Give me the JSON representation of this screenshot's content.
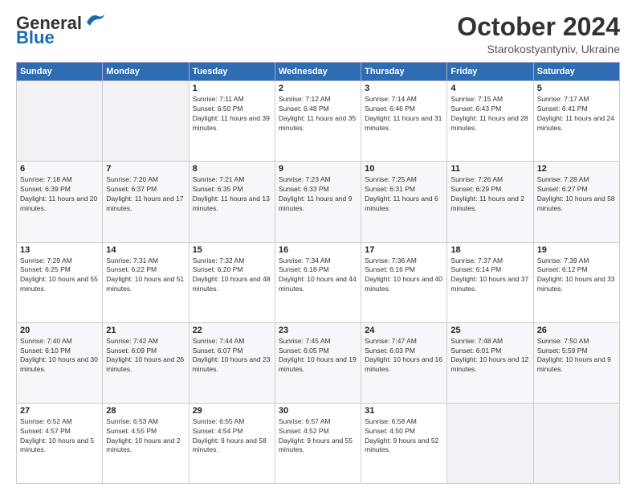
{
  "header": {
    "logo_general": "General",
    "logo_blue": "Blue",
    "month_title": "October 2024",
    "subtitle": "Starokostyantyniv, Ukraine"
  },
  "weekdays": [
    "Sunday",
    "Monday",
    "Tuesday",
    "Wednesday",
    "Thursday",
    "Friday",
    "Saturday"
  ],
  "weeks": [
    [
      {
        "day": "",
        "sunrise": "",
        "sunset": "",
        "daylight": "",
        "empty": true
      },
      {
        "day": "",
        "sunrise": "",
        "sunset": "",
        "daylight": "",
        "empty": true
      },
      {
        "day": "1",
        "sunrise": "Sunrise: 7:11 AM",
        "sunset": "Sunset: 6:50 PM",
        "daylight": "Daylight: 11 hours and 39 minutes.",
        "empty": false
      },
      {
        "day": "2",
        "sunrise": "Sunrise: 7:12 AM",
        "sunset": "Sunset: 6:48 PM",
        "daylight": "Daylight: 11 hours and 35 minutes.",
        "empty": false
      },
      {
        "day": "3",
        "sunrise": "Sunrise: 7:14 AM",
        "sunset": "Sunset: 6:46 PM",
        "daylight": "Daylight: 11 hours and 31 minutes.",
        "empty": false
      },
      {
        "day": "4",
        "sunrise": "Sunrise: 7:15 AM",
        "sunset": "Sunset: 6:43 PM",
        "daylight": "Daylight: 11 hours and 28 minutes.",
        "empty": false
      },
      {
        "day": "5",
        "sunrise": "Sunrise: 7:17 AM",
        "sunset": "Sunset: 6:41 PM",
        "daylight": "Daylight: 11 hours and 24 minutes.",
        "empty": false
      }
    ],
    [
      {
        "day": "6",
        "sunrise": "Sunrise: 7:18 AM",
        "sunset": "Sunset: 6:39 PM",
        "daylight": "Daylight: 11 hours and 20 minutes.",
        "empty": false
      },
      {
        "day": "7",
        "sunrise": "Sunrise: 7:20 AM",
        "sunset": "Sunset: 6:37 PM",
        "daylight": "Daylight: 11 hours and 17 minutes.",
        "empty": false
      },
      {
        "day": "8",
        "sunrise": "Sunrise: 7:21 AM",
        "sunset": "Sunset: 6:35 PM",
        "daylight": "Daylight: 11 hours and 13 minutes.",
        "empty": false
      },
      {
        "day": "9",
        "sunrise": "Sunrise: 7:23 AM",
        "sunset": "Sunset: 6:33 PM",
        "daylight": "Daylight: 11 hours and 9 minutes.",
        "empty": false
      },
      {
        "day": "10",
        "sunrise": "Sunrise: 7:25 AM",
        "sunset": "Sunset: 6:31 PM",
        "daylight": "Daylight: 11 hours and 6 minutes.",
        "empty": false
      },
      {
        "day": "11",
        "sunrise": "Sunrise: 7:26 AM",
        "sunset": "Sunset: 6:29 PM",
        "daylight": "Daylight: 11 hours and 2 minutes.",
        "empty": false
      },
      {
        "day": "12",
        "sunrise": "Sunrise: 7:28 AM",
        "sunset": "Sunset: 6:27 PM",
        "daylight": "Daylight: 10 hours and 58 minutes.",
        "empty": false
      }
    ],
    [
      {
        "day": "13",
        "sunrise": "Sunrise: 7:29 AM",
        "sunset": "Sunset: 6:25 PM",
        "daylight": "Daylight: 10 hours and 55 minutes.",
        "empty": false
      },
      {
        "day": "14",
        "sunrise": "Sunrise: 7:31 AM",
        "sunset": "Sunset: 6:22 PM",
        "daylight": "Daylight: 10 hours and 51 minutes.",
        "empty": false
      },
      {
        "day": "15",
        "sunrise": "Sunrise: 7:32 AM",
        "sunset": "Sunset: 6:20 PM",
        "daylight": "Daylight: 10 hours and 48 minutes.",
        "empty": false
      },
      {
        "day": "16",
        "sunrise": "Sunrise: 7:34 AM",
        "sunset": "Sunset: 6:18 PM",
        "daylight": "Daylight: 10 hours and 44 minutes.",
        "empty": false
      },
      {
        "day": "17",
        "sunrise": "Sunrise: 7:36 AM",
        "sunset": "Sunset: 6:16 PM",
        "daylight": "Daylight: 10 hours and 40 minutes.",
        "empty": false
      },
      {
        "day": "18",
        "sunrise": "Sunrise: 7:37 AM",
        "sunset": "Sunset: 6:14 PM",
        "daylight": "Daylight: 10 hours and 37 minutes.",
        "empty": false
      },
      {
        "day": "19",
        "sunrise": "Sunrise: 7:39 AM",
        "sunset": "Sunset: 6:12 PM",
        "daylight": "Daylight: 10 hours and 33 minutes.",
        "empty": false
      }
    ],
    [
      {
        "day": "20",
        "sunrise": "Sunrise: 7:40 AM",
        "sunset": "Sunset: 6:10 PM",
        "daylight": "Daylight: 10 hours and 30 minutes.",
        "empty": false
      },
      {
        "day": "21",
        "sunrise": "Sunrise: 7:42 AM",
        "sunset": "Sunset: 6:09 PM",
        "daylight": "Daylight: 10 hours and 26 minutes.",
        "empty": false
      },
      {
        "day": "22",
        "sunrise": "Sunrise: 7:44 AM",
        "sunset": "Sunset: 6:07 PM",
        "daylight": "Daylight: 10 hours and 23 minutes.",
        "empty": false
      },
      {
        "day": "23",
        "sunrise": "Sunrise: 7:45 AM",
        "sunset": "Sunset: 6:05 PM",
        "daylight": "Daylight: 10 hours and 19 minutes.",
        "empty": false
      },
      {
        "day": "24",
        "sunrise": "Sunrise: 7:47 AM",
        "sunset": "Sunset: 6:03 PM",
        "daylight": "Daylight: 10 hours and 16 minutes.",
        "empty": false
      },
      {
        "day": "25",
        "sunrise": "Sunrise: 7:48 AM",
        "sunset": "Sunset: 6:01 PM",
        "daylight": "Daylight: 10 hours and 12 minutes.",
        "empty": false
      },
      {
        "day": "26",
        "sunrise": "Sunrise: 7:50 AM",
        "sunset": "Sunset: 5:59 PM",
        "daylight": "Daylight: 10 hours and 9 minutes.",
        "empty": false
      }
    ],
    [
      {
        "day": "27",
        "sunrise": "Sunrise: 6:52 AM",
        "sunset": "Sunset: 4:57 PM",
        "daylight": "Daylight: 10 hours and 5 minutes.",
        "empty": false
      },
      {
        "day": "28",
        "sunrise": "Sunrise: 6:53 AM",
        "sunset": "Sunset: 4:55 PM",
        "daylight": "Daylight: 10 hours and 2 minutes.",
        "empty": false
      },
      {
        "day": "29",
        "sunrise": "Sunrise: 6:55 AM",
        "sunset": "Sunset: 4:54 PM",
        "daylight": "Daylight: 9 hours and 58 minutes.",
        "empty": false
      },
      {
        "day": "30",
        "sunrise": "Sunrise: 6:57 AM",
        "sunset": "Sunset: 4:52 PM",
        "daylight": "Daylight: 9 hours and 55 minutes.",
        "empty": false
      },
      {
        "day": "31",
        "sunrise": "Sunrise: 6:58 AM",
        "sunset": "Sunset: 4:50 PM",
        "daylight": "Daylight: 9 hours and 52 minutes.",
        "empty": false
      },
      {
        "day": "",
        "sunrise": "",
        "sunset": "",
        "daylight": "",
        "empty": true
      },
      {
        "day": "",
        "sunrise": "",
        "sunset": "",
        "daylight": "",
        "empty": true
      }
    ]
  ]
}
